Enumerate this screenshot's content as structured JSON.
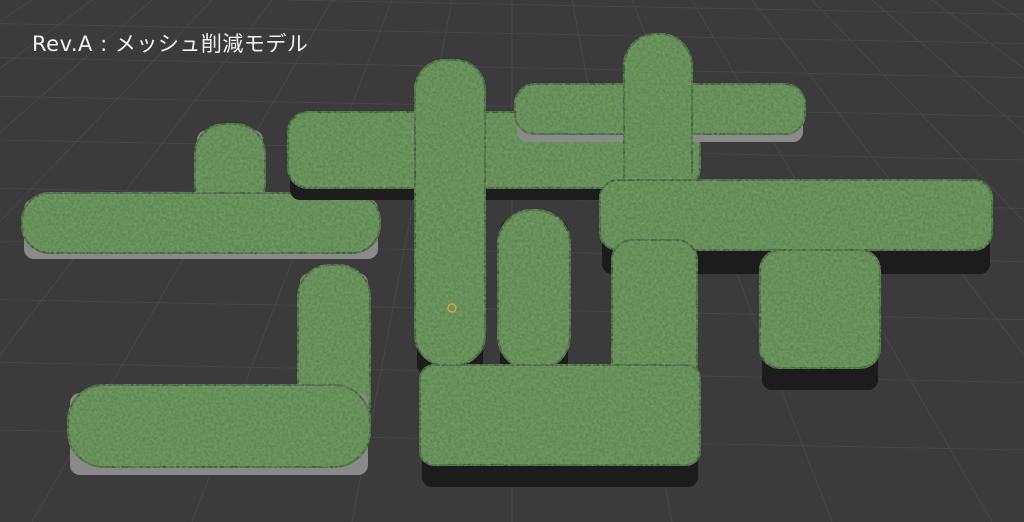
{
  "caption": "Rev.A : メッシュ削減モデル",
  "colors": {
    "background": "#3b3b3b",
    "grid": "#474747",
    "hedge_top": "#5f8a4e",
    "hedge_dark": "#3c5c32",
    "hedge_side": "#1c1c1c",
    "base_plate": "#8a8a8a"
  },
  "icons": {
    "origin_marker": "object-origin-icon"
  }
}
